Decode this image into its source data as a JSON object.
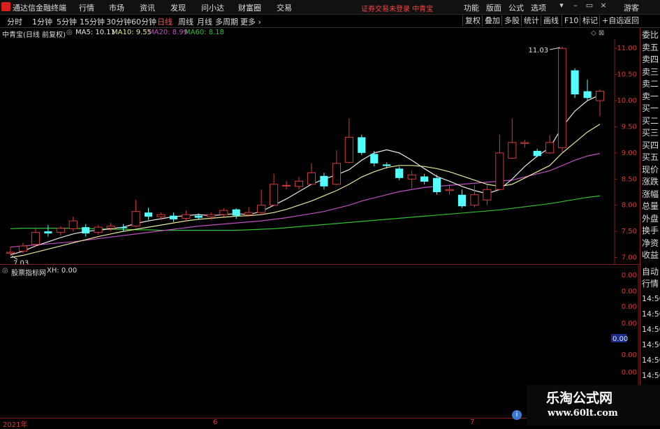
{
  "app_title": "通达信金融终端",
  "menu": [
    "行情",
    "市场",
    "资讯",
    "发现",
    "问小达",
    "财富圈",
    "交易"
  ],
  "warning": "证券交易未登录",
  "stock_name_top": "中青宝",
  "right_menu": [
    "功能",
    "版面",
    "公式",
    "选项"
  ],
  "guest": "游客",
  "periods": [
    "分时",
    "1分钟",
    "5分钟",
    "15分钟",
    "30分钟",
    "60分钟",
    "日线",
    "周线",
    "月线",
    "多周期",
    "更多"
  ],
  "active_period": "日线",
  "tools": [
    "复权",
    "叠加",
    "多股",
    "统计",
    "画线",
    "F10",
    "标记",
    "+自选",
    "返回"
  ],
  "info": {
    "name": "中青宝(日线 前复权)",
    "ma5": "MA5: 10.11",
    "ma10": "MA10: 9.55",
    "ma20": "MA20: 8.99",
    "ma60": "MA60: 8.18"
  },
  "sub_info": {
    "name": "股票指标网",
    "xh": "XH: 0.00"
  },
  "right_labels": [
    "委比",
    "卖五",
    "卖四",
    "卖三",
    "卖二",
    "卖一",
    "买一",
    "买二",
    "买三",
    "买四",
    "买五",
    "现价",
    "涨跌",
    "涨幅",
    "总量",
    "外盘",
    "换手",
    "净资",
    "收益"
  ],
  "right_labels2": [
    "自动",
    "行情"
  ],
  "sub_values": [
    "0.00",
    "0.00",
    "0.00",
    "0.00",
    "0.00",
    "0.00",
    "0.00",
    "0.00",
    "0.00"
  ],
  "sub_value_highlight": "0.00",
  "sub_times": [
    "14:50",
    "14:50",
    "14:50",
    "14:50",
    "14:50",
    "14:50",
    "14:50",
    "14:50"
  ],
  "time_labels": [
    "2021年",
    "6",
    "7"
  ],
  "watermark": {
    "title": "乐淘公式网",
    "url": "www.60lt.com"
  },
  "colors": {
    "up": "#d23c3c",
    "down": "#54ffff",
    "ma5": "#e8e8e8",
    "ma10": "#e8e89a",
    "ma20": "#c050c0",
    "ma60": "#30c030"
  },
  "chart_data": {
    "type": "candlestick",
    "y_ticks": [
      7.0,
      7.5,
      8.0,
      8.5,
      9.0,
      9.5,
      10.0,
      10.5,
      11.0
    ],
    "ylim": [
      6.9,
      11.15
    ],
    "high_label": "11.03",
    "low_label": "7.03",
    "candles": [
      [
        7.08,
        7.1,
        7.2,
        7.03
      ],
      [
        7.12,
        7.22,
        7.28,
        7.08
      ],
      [
        7.25,
        7.48,
        7.55,
        7.2
      ],
      [
        7.5,
        7.46,
        7.62,
        7.4
      ],
      [
        7.48,
        7.56,
        7.6,
        7.42
      ],
      [
        7.55,
        7.7,
        7.78,
        7.5
      ],
      [
        7.58,
        7.46,
        7.64,
        7.4
      ],
      [
        7.48,
        7.58,
        7.62,
        7.44
      ],
      [
        7.56,
        7.6,
        7.66,
        7.5
      ],
      [
        7.58,
        7.56,
        7.64,
        7.5
      ],
      [
        7.6,
        7.88,
        8.1,
        7.58
      ],
      [
        7.86,
        7.78,
        7.95,
        7.72
      ],
      [
        7.78,
        7.82,
        7.86,
        7.72
      ],
      [
        7.8,
        7.73,
        7.86,
        7.68
      ],
      [
        7.75,
        7.82,
        7.9,
        7.7
      ],
      [
        7.8,
        7.76,
        7.84,
        7.72
      ],
      [
        7.78,
        7.82,
        7.86,
        7.72
      ],
      [
        7.82,
        7.9,
        7.94,
        7.78
      ],
      [
        7.92,
        7.8,
        7.94,
        7.74
      ],
      [
        7.82,
        7.86,
        7.96,
        7.78
      ],
      [
        7.86,
        8.0,
        8.3,
        7.82
      ],
      [
        8.0,
        8.4,
        8.6,
        7.98
      ],
      [
        8.38,
        8.38,
        8.46,
        8.3
      ],
      [
        8.36,
        8.46,
        8.54,
        8.3
      ],
      [
        8.4,
        8.62,
        8.8,
        8.38
      ],
      [
        8.56,
        8.36,
        8.62,
        8.3
      ],
      [
        8.4,
        8.8,
        9.05,
        8.38
      ],
      [
        8.82,
        9.3,
        9.66,
        8.8
      ],
      [
        9.3,
        9.0,
        9.35,
        8.96
      ],
      [
        8.98,
        8.8,
        9.04,
        8.74
      ],
      [
        8.78,
        8.75,
        8.82,
        8.7
      ],
      [
        8.7,
        8.52,
        8.74,
        8.48
      ],
      [
        8.5,
        8.58,
        8.66,
        8.32
      ],
      [
        8.55,
        8.45,
        8.6,
        8.4
      ],
      [
        8.52,
        8.25,
        8.58,
        8.2
      ],
      [
        8.28,
        8.3,
        8.4,
        8.2
      ],
      [
        8.2,
        7.98,
        8.3,
        7.95
      ],
      [
        8.0,
        8.2,
        8.38,
        7.96
      ],
      [
        8.1,
        8.3,
        8.4,
        8.0
      ],
      [
        8.3,
        9.0,
        9.35,
        8.28
      ],
      [
        8.9,
        9.2,
        9.66,
        8.88
      ],
      [
        9.18,
        9.2,
        9.25,
        9.1
      ],
      [
        9.04,
        8.94,
        9.08,
        8.92
      ],
      [
        9.0,
        9.2,
        9.34,
        8.98
      ],
      [
        9.1,
        11.0,
        11.03,
        9.0
      ],
      [
        10.58,
        10.12,
        10.62,
        10.05
      ],
      [
        10.18,
        10.05,
        10.4,
        10.0
      ],
      [
        10.0,
        10.18,
        10.22,
        9.7
      ]
    ],
    "ma5": [
      7.05,
      7.12,
      7.22,
      7.3,
      7.38,
      7.45,
      7.5,
      7.52,
      7.55,
      7.58,
      7.65,
      7.7,
      7.74,
      7.78,
      7.8,
      7.82,
      7.8,
      7.82,
      7.84,
      7.82,
      7.88,
      8.0,
      8.12,
      8.26,
      8.4,
      8.5,
      8.58,
      8.68,
      8.86,
      9.0,
      9.06,
      9.0,
      8.86,
      8.7,
      8.55,
      8.46,
      8.36,
      8.28,
      8.22,
      8.3,
      8.5,
      8.74,
      8.94,
      9.1,
      9.5,
      9.8,
      10.0,
      10.11
    ],
    "ma10": [
      7.0,
      7.04,
      7.1,
      7.16,
      7.22,
      7.28,
      7.34,
      7.4,
      7.45,
      7.5,
      7.54,
      7.58,
      7.62,
      7.66,
      7.7,
      7.73,
      7.75,
      7.77,
      7.79,
      7.8,
      7.82,
      7.86,
      7.92,
      8.0,
      8.08,
      8.18,
      8.28,
      8.4,
      8.54,
      8.64,
      8.72,
      8.76,
      8.76,
      8.74,
      8.7,
      8.64,
      8.56,
      8.48,
      8.4,
      8.36,
      8.4,
      8.52,
      8.64,
      8.76,
      9.0,
      9.2,
      9.4,
      9.55
    ],
    "ma20": [
      7.2,
      7.22,
      7.24,
      7.26,
      7.28,
      7.3,
      7.33,
      7.36,
      7.39,
      7.42,
      7.45,
      7.48,
      7.51,
      7.54,
      7.57,
      7.6,
      7.62,
      7.64,
      7.66,
      7.68,
      7.7,
      7.73,
      7.76,
      7.8,
      7.84,
      7.88,
      7.94,
      8.0,
      8.08,
      8.14,
      8.2,
      8.26,
      8.3,
      8.34,
      8.36,
      8.38,
      8.4,
      8.42,
      8.44,
      8.46,
      8.48,
      8.54,
      8.6,
      8.66,
      8.76,
      8.86,
      8.94,
      8.99
    ],
    "ma60": [
      7.55,
      7.56,
      7.56,
      7.56,
      7.56,
      7.56,
      7.55,
      7.55,
      7.54,
      7.54,
      7.53,
      7.53,
      7.52,
      7.52,
      7.52,
      7.52,
      7.52,
      7.52,
      7.52,
      7.53,
      7.54,
      7.55,
      7.57,
      7.59,
      7.61,
      7.63,
      7.65,
      7.67,
      7.69,
      7.71,
      7.73,
      7.75,
      7.77,
      7.79,
      7.81,
      7.83,
      7.85,
      7.87,
      7.89,
      7.91,
      7.94,
      7.97,
      8.0,
      8.03,
      8.07,
      8.11,
      8.15,
      8.18
    ]
  }
}
